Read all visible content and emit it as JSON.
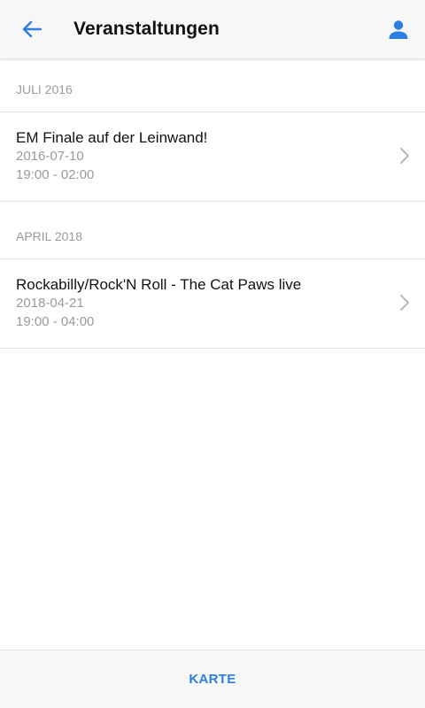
{
  "header": {
    "title": "Veranstaltungen",
    "back_icon": "arrow-left-icon",
    "profile_icon": "person-icon",
    "accent_color": "#2b7fe0"
  },
  "sections": [
    {
      "label": "JULI 2016",
      "events": [
        {
          "title": "EM Finale auf der Leinwand!",
          "date": "2016-07-10",
          "time": "19:00 - 02:00"
        }
      ]
    },
    {
      "label": "APRIL 2018",
      "events": [
        {
          "title": "Rockabilly/Rock'N Roll - The Cat Paws live",
          "date": "2018-04-21",
          "time": "19:00 - 04:00"
        }
      ]
    }
  ],
  "bottom_bar": {
    "map_label": "KARTE"
  }
}
